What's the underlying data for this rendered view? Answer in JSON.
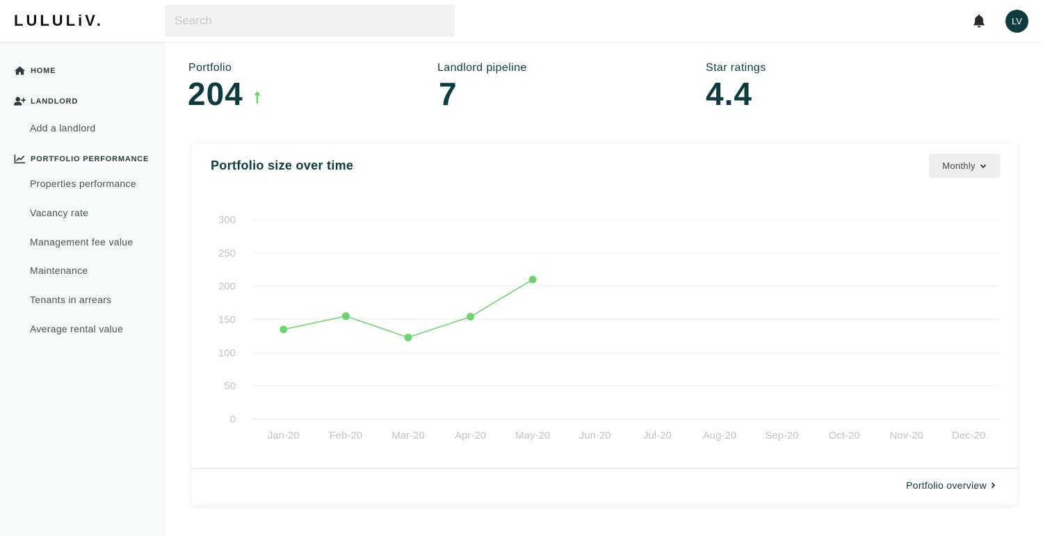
{
  "header": {
    "logo": "LULULiV.",
    "search_placeholder": "Search",
    "avatar_initials": "LV"
  },
  "sidebar": {
    "home": "HOME",
    "landlord": "LANDLORD",
    "add_landlord": "Add a landlord",
    "portfolio_performance": "PORTFOLIO PERFORMANCE",
    "items": [
      "Properties performance",
      "Vacancy rate",
      "Management fee value",
      "Maintenance",
      "Tenants in arrears",
      "Average rental value"
    ]
  },
  "stats": {
    "portfolio_label": "Portfolio",
    "portfolio_value": "204",
    "pipeline_label": "Landlord pipeline",
    "pipeline_value": "7",
    "rating_label": "Star ratings",
    "rating_value": "4.4"
  },
  "card": {
    "title": "Portfolio size over time",
    "period": "Monthly",
    "footer_link": "Portfolio overview"
  },
  "colors": {
    "accent": "#6fd46f",
    "brand_dark": "#0d3b3e"
  },
  "chart_data": {
    "type": "line",
    "title": "Portfolio size over time",
    "x": [
      "Jan-20",
      "Feb-20",
      "Mar-20",
      "Apr-20",
      "May-20",
      "Jun-20",
      "Jul-20",
      "Aug-20",
      "Sep-20",
      "Oct-20",
      "Nov-20",
      "Dec-20"
    ],
    "series": [
      {
        "values": [
          135,
          155,
          123,
          154,
          210,
          null,
          null,
          null,
          null,
          null,
          null,
          null
        ]
      }
    ],
    "yticks": [
      0,
      50,
      100,
      150,
      200,
      250,
      300
    ],
    "ylim": [
      0,
      300
    ],
    "grid": true
  }
}
